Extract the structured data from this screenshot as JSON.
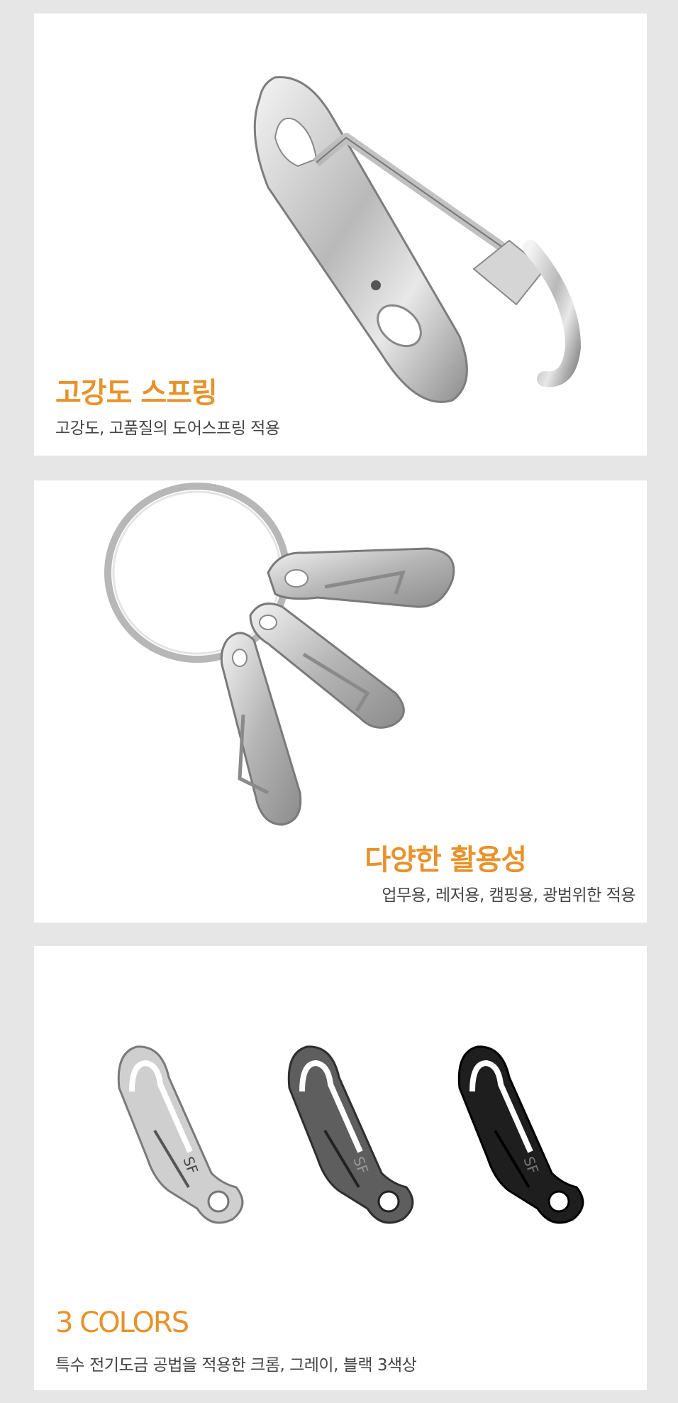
{
  "sections": [
    {
      "title": "고강도 스프링",
      "subtitle": "고강도, 고품질의 도어스프링 적용"
    },
    {
      "title": "다양한 활용성",
      "subtitle": "업무용, 레저용, 캠핑용, 광범위한 적용"
    },
    {
      "title": "3 COLORS",
      "subtitle": "특수 전기도금 공법을 적용한 크롬, 그레이, 블랙 3색상"
    }
  ],
  "clip_engraving": "SF",
  "colors": {
    "page_bg": "#e6e6e6",
    "panel_bg": "#ffffff",
    "accent": "#e8922a",
    "chrome": "#cfcfcf",
    "gray": "#5e5e5e",
    "black": "#1e1e1e"
  }
}
